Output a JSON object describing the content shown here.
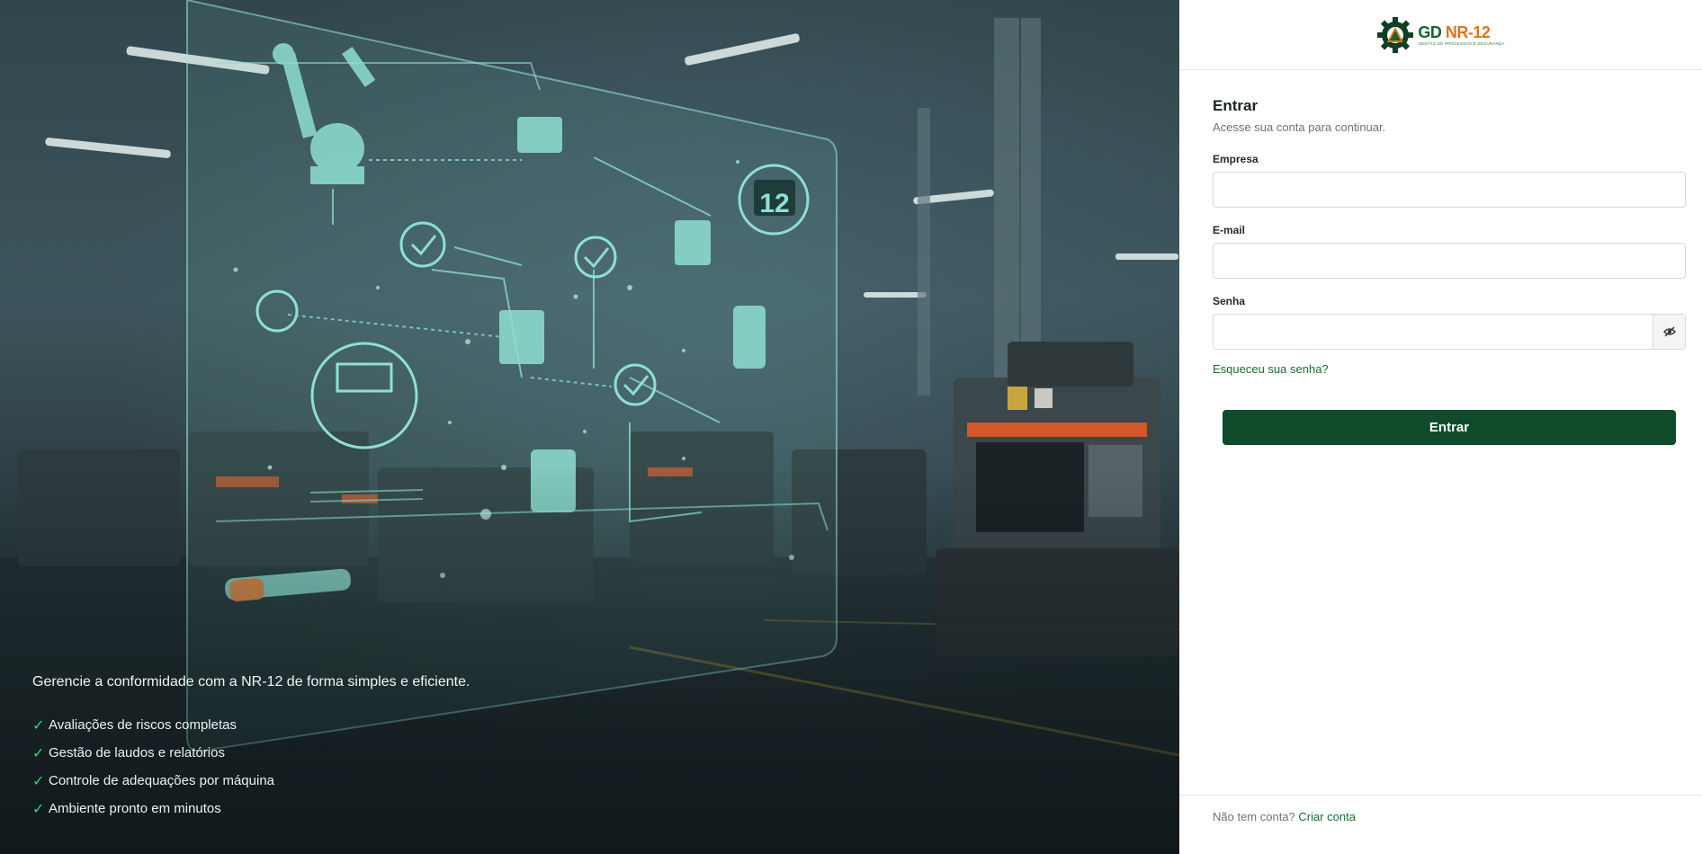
{
  "hero": {
    "headline": "Gerencie a conformidade com a NR-12 de forma simples e eficiente.",
    "features": [
      "Avaliações de riscos completas",
      "Gestão de laudos e relatórios",
      "Controle de adequações por máquina",
      "Ambiente pronto em minutos"
    ],
    "check_glyph": "✓",
    "hologram_badge": "12"
  },
  "logo": {
    "gd": "GD",
    "nr": "NR-12",
    "tagline": "GESTÃO DE PROCESSOS E SEGURANÇA",
    "brand_green": "#17642f",
    "brand_orange": "#e2731c"
  },
  "form": {
    "title": "Entrar",
    "subtitle": "Acesse sua conta para continuar.",
    "company_label": "Empresa",
    "company_value": "",
    "email_label": "E-mail",
    "email_value": "",
    "password_label": "Senha",
    "password_value": "",
    "toggle_icon": "eye-slash-icon",
    "forgot_label": "Esqueceu sua senha?",
    "submit_label": "Entrar",
    "accent": "#0f4b2b"
  },
  "footer": {
    "prompt": "Não tem conta?",
    "signup_label": "Criar conta"
  }
}
